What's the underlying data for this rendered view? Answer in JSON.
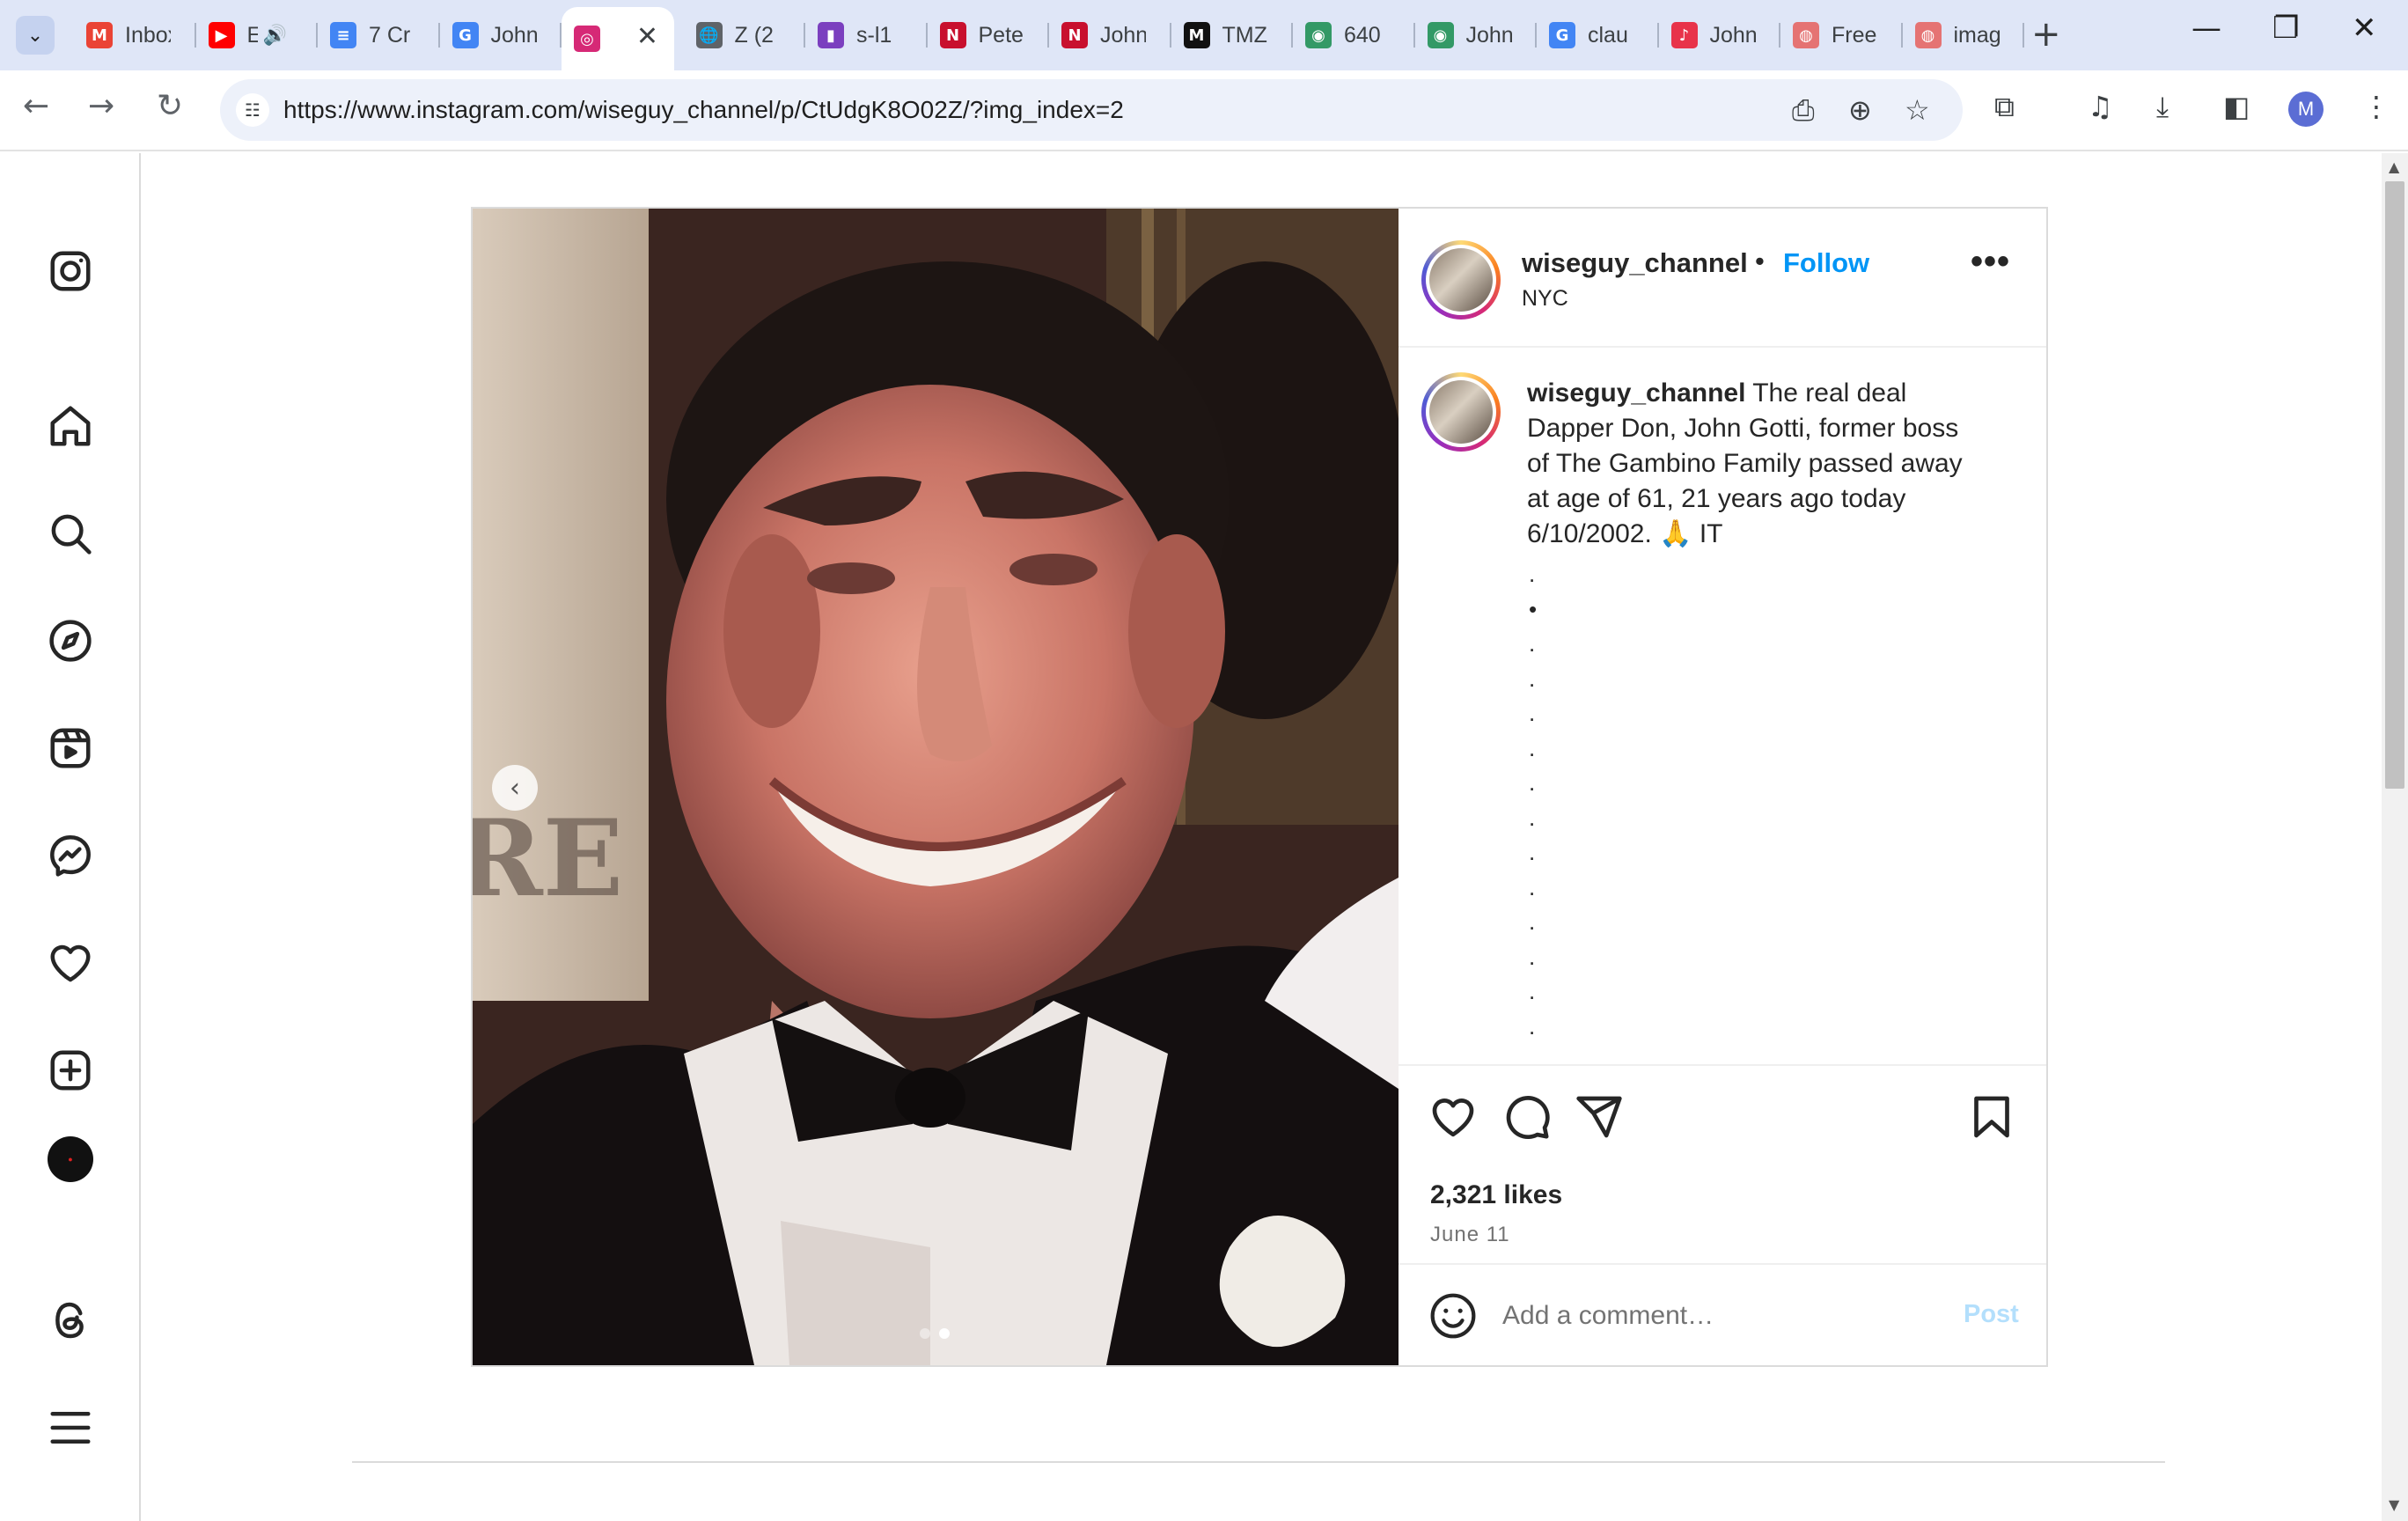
{
  "browser": {
    "tabs": [
      {
        "icon": "gmail-icon",
        "title": "Inbox",
        "color": "#ea4335",
        "glyph": "M"
      },
      {
        "icon": "youtube-icon",
        "title": "E",
        "color": "#ff0000",
        "glyph": "▶",
        "audio": "🔊"
      },
      {
        "icon": "docs-icon",
        "title": "7 Cr",
        "color": "#4285f4",
        "glyph": "≡"
      },
      {
        "icon": "google-icon",
        "title": "John",
        "color": "#4285f4",
        "glyph": "G"
      },
      {
        "icon": "instagram-icon",
        "title": "",
        "color": "#d62976",
        "glyph": "◎",
        "active": true
      },
      {
        "icon": "globe-icon",
        "title": "Z (2",
        "color": "#5f6368",
        "glyph": "🌐"
      },
      {
        "icon": "shopping-icon",
        "title": "s-l1",
        "color": "#7b3fbf",
        "glyph": "▮"
      },
      {
        "icon": "nypost-icon",
        "title": "Pete",
        "color": "#c8102e",
        "glyph": "N"
      },
      {
        "icon": "nypost-icon",
        "title": "John",
        "color": "#c8102e",
        "glyph": "N"
      },
      {
        "icon": "tmz-icon",
        "title": "TMZ",
        "color": "#111111",
        "glyph": "M"
      },
      {
        "icon": "wikimedia-icon",
        "title": "640",
        "color": "#339966",
        "glyph": "◉"
      },
      {
        "icon": "wikimedia-icon",
        "title": "John",
        "color": "#339966",
        "glyph": "◉"
      },
      {
        "icon": "google-icon",
        "title": "clau",
        "color": "#4285f4",
        "glyph": "G"
      },
      {
        "icon": "app-icon",
        "title": "John",
        "color": "#e8334a",
        "glyph": "♪"
      },
      {
        "icon": "web-icon",
        "title": "Free",
        "color": "#e57373",
        "glyph": "◍"
      },
      {
        "icon": "web-icon",
        "title": "imag",
        "color": "#e57373",
        "glyph": "◍"
      }
    ],
    "close_tab": "✕",
    "new_tab": "+",
    "tab_search": "⌄",
    "window": {
      "minimize": "—",
      "restore": "❐",
      "close": "✕"
    },
    "nav": {
      "back": "←",
      "forward": "→",
      "reload": "↻"
    },
    "url": "https://www.instagram.com/wiseguy_channel/p/CtUdgK8O02Z/?img_index=2",
    "profile_initial": "M"
  },
  "post": {
    "username": "wiseguy_channel",
    "follow_label": "Follow",
    "separator": "•",
    "location": "NYC",
    "more": "•••",
    "caption_user": "wiseguy_channel",
    "caption_text": "The real deal Dapper Don, John Gotti, former boss of The Gambino Family passed away at age of 61, 21 years ago today 6/10/2002. 🙏 IT",
    "caption_dots": [
      ".",
      "•",
      ".",
      ".",
      ".",
      ".",
      ".",
      ".",
      ".",
      ".",
      ".",
      ".",
      ".",
      "."
    ],
    "likes": "2,321 likes",
    "date": "June 11",
    "comment_placeholder": "Add a comment…",
    "post_label": "Post",
    "carousel": {
      "current": 2,
      "total": 2,
      "prev": "‹"
    }
  },
  "colors": {
    "follow": "#0095f6",
    "post_disabled": "#b3dffc",
    "tabstrip": "#dfe6f7"
  }
}
